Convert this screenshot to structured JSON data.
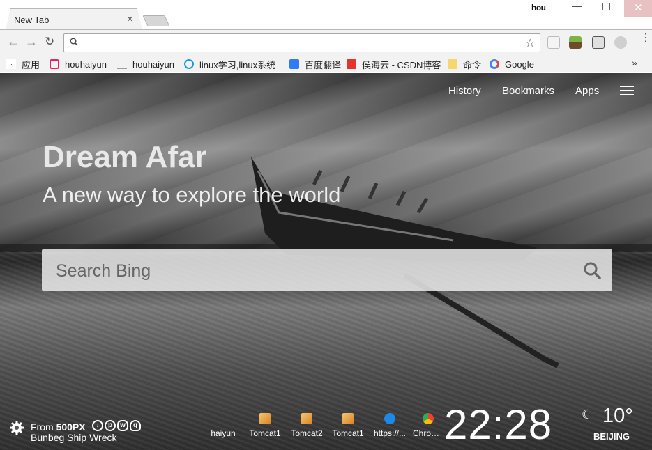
{
  "browser": {
    "tab_title": "New Tab",
    "tab_close": "×",
    "user_badge": "hou",
    "omnibox_value": "",
    "menu_glyph": "⋮"
  },
  "bookmarks": [
    {
      "label": "应用",
      "icon": "apps-grid-icon",
      "color": "#4285f4"
    },
    {
      "label": "houhaiyun",
      "icon": "bookmark-pink-icon",
      "color": "#e91e63"
    },
    {
      "label": "houhaiyun",
      "icon": "bookmark-grey-icon",
      "color": "#9e9e9e"
    },
    {
      "label": "linux学习,linux系统",
      "icon": "linux-site-icon",
      "color": "#1a9bd7"
    },
    {
      "label": "百度翻译",
      "icon": "baidu-translate-icon",
      "color": "#2f7bf6"
    },
    {
      "label": "侯海云 - CSDN博客",
      "icon": "csdn-icon",
      "color": "#e5322d"
    },
    {
      "label": "命令",
      "icon": "folder-icon",
      "color": "#f5d76e"
    },
    {
      "label": "Google",
      "icon": "google-icon",
      "color": "#4285f4"
    }
  ],
  "nav": {
    "history": "History",
    "bookmarks": "Bookmarks",
    "apps": "Apps"
  },
  "hero": {
    "headline": "Dream Afar",
    "subline": "A new way to explore the world"
  },
  "search": {
    "placeholder": "Search Bing"
  },
  "credit": {
    "from_prefix": "From ",
    "source": "500PX",
    "title": "Bunbeg Ship Wreck"
  },
  "shortcuts": [
    {
      "label": "haiyun",
      "icon": "none"
    },
    {
      "label": "Tomcat1",
      "icon": "tomcat-icon"
    },
    {
      "label": "Tomcat2",
      "icon": "tomcat-icon"
    },
    {
      "label": "Tomcat1",
      "icon": "tomcat-icon"
    },
    {
      "label": "https://...",
      "icon": "site-blue-icon"
    },
    {
      "label": "Chrom...",
      "icon": "chrome-icon"
    }
  ],
  "clock": "22:28",
  "weather": {
    "icon": "moon-icon",
    "temperature": "10°",
    "city": "BEIJING"
  }
}
